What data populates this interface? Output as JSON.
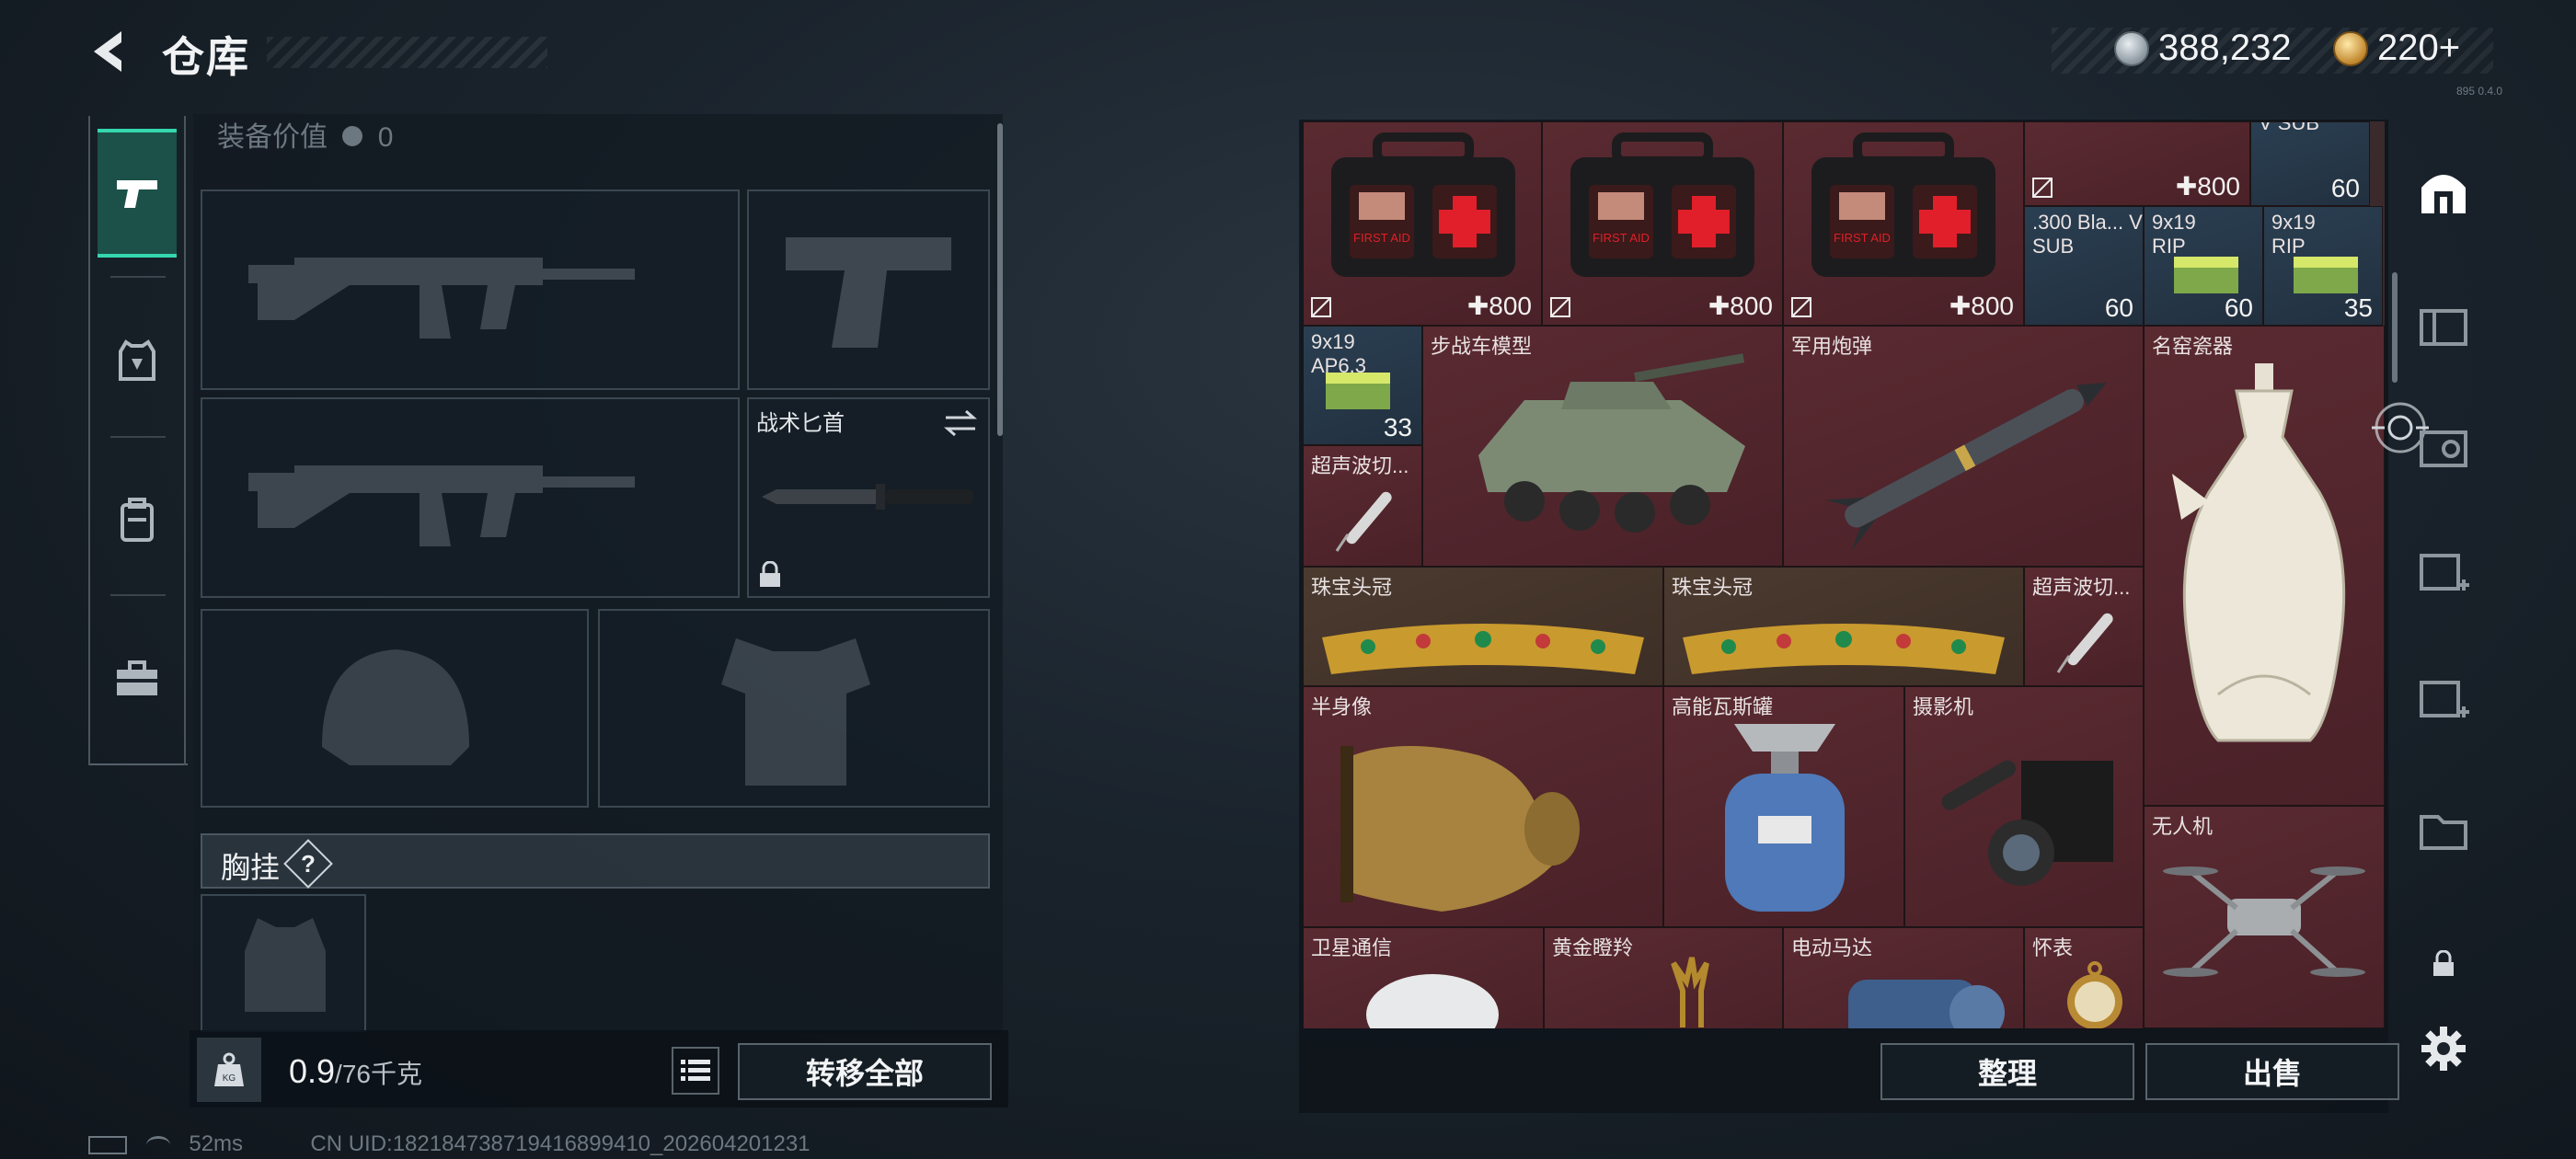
{
  "header": {
    "title": "仓库",
    "currency_silver": "388,232",
    "currency_gold": "220+",
    "version_small": "895 0.4.0"
  },
  "loadout": {
    "equip_value_label": "装备价值",
    "equip_value": "0",
    "knife_slot_label": "战术匕首",
    "chest_rig_label": "胸挂",
    "help_mark": "?"
  },
  "footer_left": {
    "weight_value": "0.9",
    "weight_max": "/76千克",
    "transfer_all": "转移全部"
  },
  "status": {
    "ping": "52ms",
    "uid": "CN UID:18218473871941689941​0_202604201231"
  },
  "stash": {
    "items": [
      {
        "name": "",
        "price": "✚800"
      },
      {
        "name": "",
        "price": "✚800"
      },
      {
        "name": "",
        "price": "✚800"
      },
      {
        "name": "",
        "price": "✚800"
      },
      {
        "name": "V SUB",
        "count": "60"
      },
      {
        "name": ".300 Bla... V SUB",
        "count": "60"
      },
      {
        "name": "9x19 RIP",
        "count": "60"
      },
      {
        "name": "9x19 RIP",
        "count": "35"
      },
      {
        "name": "9x19 AP6.3",
        "count": "33"
      },
      {
        "name": "步战车模型"
      },
      {
        "name": "军用炮弹"
      },
      {
        "name": "名窑瓷器"
      },
      {
        "name": "超声波切..."
      },
      {
        "name": "珠宝头冠"
      },
      {
        "name": "珠宝头冠"
      },
      {
        "name": "超声波切..."
      },
      {
        "name": "半身像"
      },
      {
        "name": "高能瓦斯罐"
      },
      {
        "name": "摄影机"
      },
      {
        "name": "无人机"
      },
      {
        "name": "卫星通信"
      },
      {
        "name": "黄金瞪羚"
      },
      {
        "name": "电动马达"
      },
      {
        "name": "怀表"
      }
    ]
  },
  "footer_right": {
    "sort": "整理",
    "sell": "出售"
  },
  "colors": {
    "accent_teal": "#35d7ae",
    "item_red": "#5a2a31",
    "item_blue": "#2a3f52"
  }
}
